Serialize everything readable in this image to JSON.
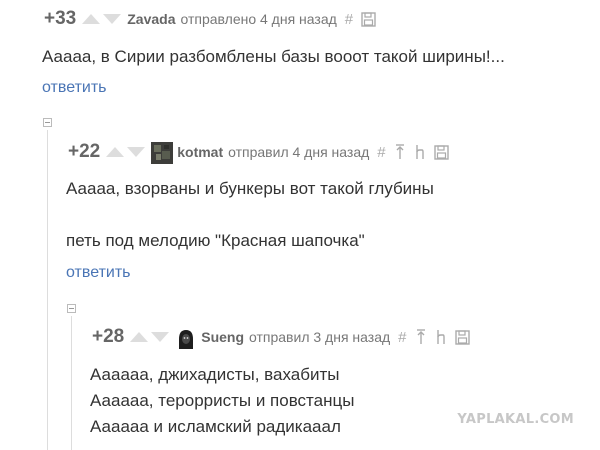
{
  "comments": [
    {
      "rating": "+33",
      "author": "Zavada",
      "sent": "отправлено 4 дня назад",
      "tools": [
        "#"
      ],
      "text": [
        "Ааааа, в Сирии разбомблены базы вооот такой ширины!..."
      ],
      "reply": "ответить"
    },
    {
      "rating": "+22",
      "author": "kotmat",
      "sent": "отправил 4 дня назад",
      "tools": [
        "#"
      ],
      "text": [
        "Ааааа, взорваны и бункеры вот такой глубины",
        "",
        "петь под мелодию \"Красная шапочка\""
      ],
      "reply": "ответить"
    },
    {
      "rating": "+28",
      "author": "Sueng",
      "sent": "отправил 3 дня назад",
      "tools": [
        "#"
      ],
      "text": [
        "Аааааа, джихадисты, вахабиты",
        "Аааааа, терорристы и повстанцы",
        "Аааааа и исламский радикааал"
      ]
    }
  ],
  "watermark": "YAPLAKAL.COM",
  "colors": {
    "link": "#4a75b5",
    "text": "#333333",
    "meta": "#666666",
    "icon": "#aaaaaa"
  }
}
